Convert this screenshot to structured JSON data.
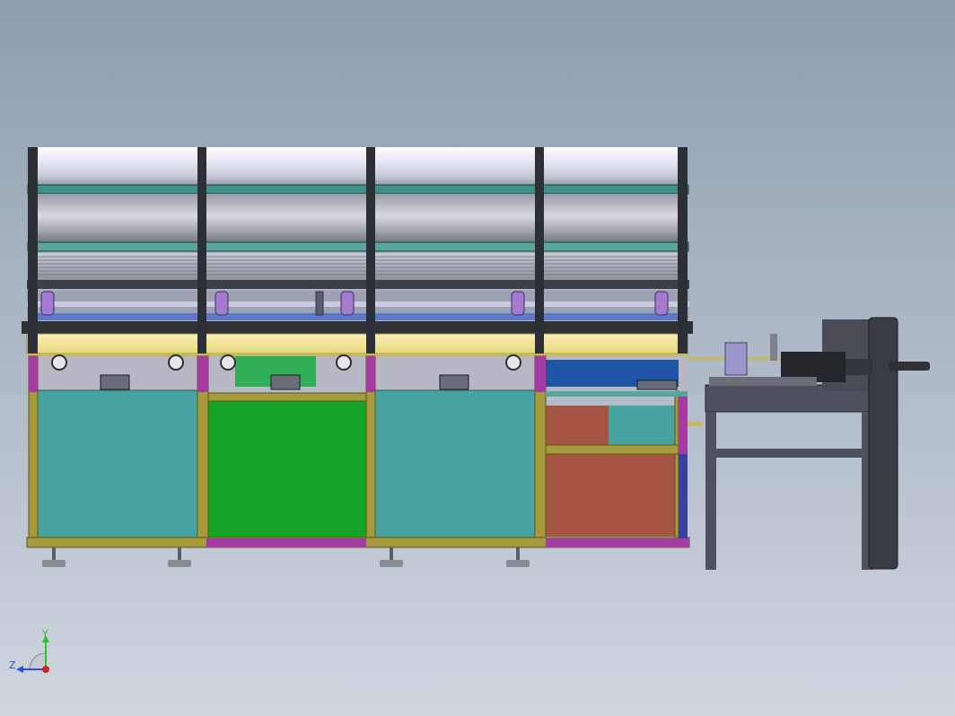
{
  "view": {
    "background_top": "#8e9db0",
    "background_bottom": "#cfd6de"
  },
  "triad": {
    "y_label": "Y",
    "z_label": "Z",
    "y_color": "#27c427",
    "z_color": "#2b4de0",
    "origin_color": "#d62020"
  },
  "machine": {
    "left_bay_color": "#47a3a0",
    "green_bay_color": "#14a325",
    "orange_panel_color": "#a65545",
    "frame_color": "#a69a3c",
    "base_accent_color": "#a53aa3",
    "roller_color": "#eaeaf4",
    "rail_color": "#5aa69f",
    "blue_block_color": "#1f55a8",
    "stand_color": "#4f525c"
  }
}
